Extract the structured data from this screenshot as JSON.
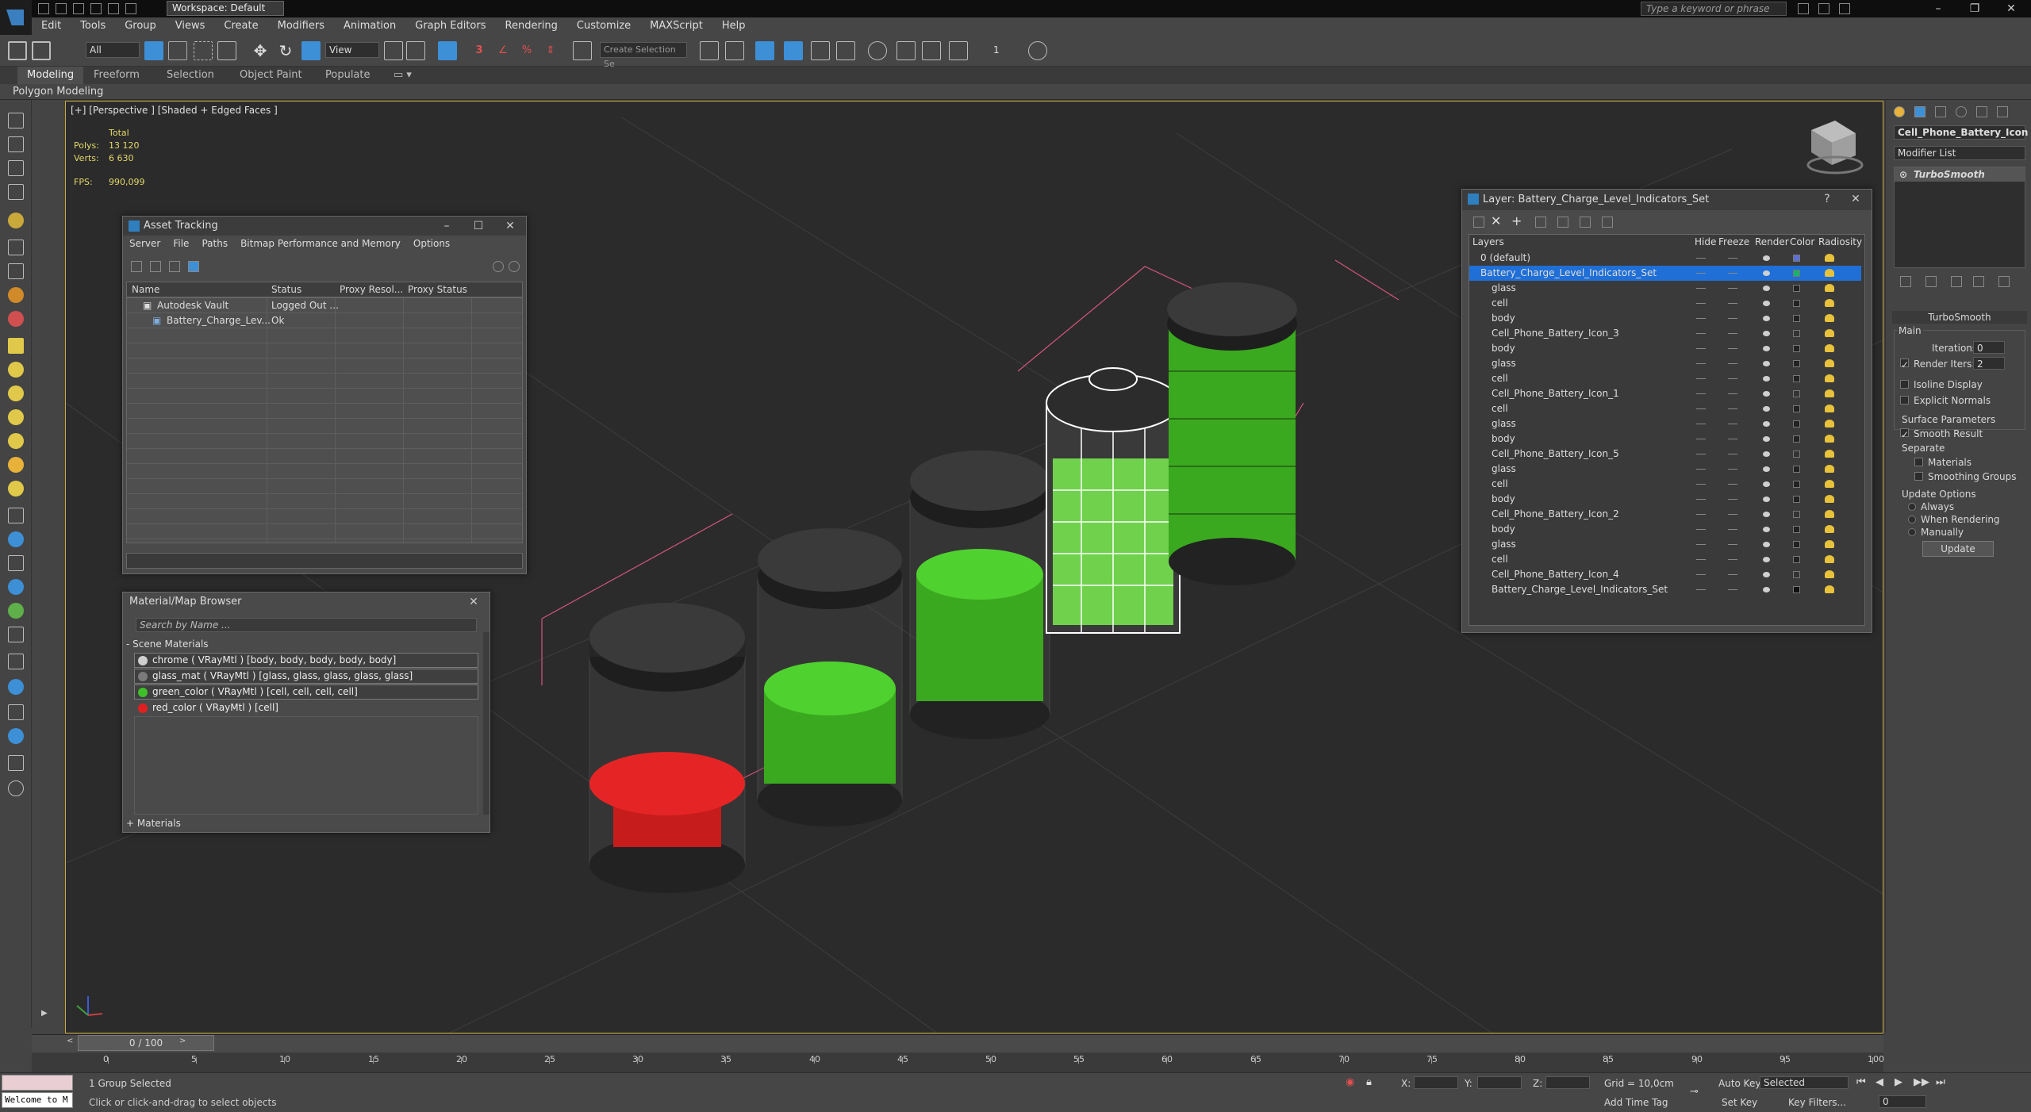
{
  "titlebar": {
    "workspace": "Workspace: Default",
    "search_placeholder": "Type a keyword or phrase"
  },
  "menubar": {
    "items": [
      "Edit",
      "Tools",
      "Group",
      "Views",
      "Create",
      "Modifiers",
      "Animation",
      "Graph Editors",
      "Rendering",
      "Customize",
      "MAXScript",
      "Help"
    ]
  },
  "toolbar": {
    "filter": "All",
    "ref_coord": "View",
    "named_selection": "Create Selection Se",
    "snap_count": "1"
  },
  "ribbon": {
    "tabs": [
      "Modeling",
      "Freeform",
      "Selection",
      "Object Paint",
      "Populate"
    ],
    "active_tab": "Modeling",
    "subpanel": "Polygon Modeling"
  },
  "viewport": {
    "label": "[+] [Perspective ] [Shaded + Edged Faces ]",
    "stats_header": "Total",
    "polys_label": "Polys:",
    "polys_value": "13 120",
    "verts_label": "Verts:",
    "verts_value": "6 630",
    "fps_label": "FPS:",
    "fps_value": "990,099"
  },
  "asset_tracking": {
    "title": "Asset Tracking",
    "menu": [
      "Server",
      "File",
      "Paths",
      "Bitmap Performance and Memory",
      "Options"
    ],
    "columns": [
      "Name",
      "Status",
      "Proxy Resol...",
      "Proxy Status"
    ],
    "rows": [
      {
        "name": "Autodesk Vault",
        "status": "Logged Out ..."
      },
      {
        "name": "Battery_Charge_Lev...",
        "status": "Ok"
      }
    ]
  },
  "material_browser": {
    "title": "Material/Map Browser",
    "search_placeholder": "Search by Name ...",
    "section": "- Scene Materials",
    "items": [
      {
        "label": "chrome ( VRayMtl ) [body, body, body, body, body]",
        "color": "#cfcfcf"
      },
      {
        "label": "glass_mat ( VRayMtl ) [glass, glass, glass, glass, glass]",
        "color": "#7a7a7a"
      },
      {
        "label": "green_color ( VRayMtl ) [cell, cell, cell, cell]",
        "color": "#3fbf2a"
      },
      {
        "label": "red_color ( VRayMtl ) [cell]",
        "color": "#e02020"
      }
    ],
    "footer": "+ Materials"
  },
  "layer_explorer": {
    "title": "Layer: Battery_Charge_Level_Indicators_Set",
    "columns": [
      "Layers",
      "Hide",
      "Freeze",
      "Render",
      "Color",
      "Radiosity"
    ],
    "rows": [
      {
        "name": "0 (default)",
        "indent": 1,
        "swatch": "#5a6fd8"
      },
      {
        "name": "Battery_Charge_Level_Indicators_Set",
        "indent": 1,
        "selected": true,
        "swatch": "#1ab36a"
      },
      {
        "name": "glass",
        "indent": 2,
        "swatch": "#222"
      },
      {
        "name": "cell",
        "indent": 2,
        "swatch": "#222"
      },
      {
        "name": "body",
        "indent": 2,
        "swatch": "#222"
      },
      {
        "name": "Cell_Phone_Battery_Icon_3",
        "indent": 2,
        "swatch": "#333"
      },
      {
        "name": "body",
        "indent": 2,
        "swatch": "#222"
      },
      {
        "name": "glass",
        "indent": 2,
        "swatch": "#222"
      },
      {
        "name": "cell",
        "indent": 2,
        "swatch": "#222"
      },
      {
        "name": "Cell_Phone_Battery_Icon_1",
        "indent": 2,
        "swatch": "#333"
      },
      {
        "name": "cell",
        "indent": 2,
        "swatch": "#222"
      },
      {
        "name": "glass",
        "indent": 2,
        "swatch": "#222"
      },
      {
        "name": "body",
        "indent": 2,
        "swatch": "#222"
      },
      {
        "name": "Cell_Phone_Battery_Icon_5",
        "indent": 2,
        "swatch": "#333"
      },
      {
        "name": "glass",
        "indent": 2,
        "swatch": "#222"
      },
      {
        "name": "cell",
        "indent": 2,
        "swatch": "#222"
      },
      {
        "name": "body",
        "indent": 2,
        "swatch": "#222"
      },
      {
        "name": "Cell_Phone_Battery_Icon_2",
        "indent": 2,
        "swatch": "#333"
      },
      {
        "name": "body",
        "indent": 2,
        "swatch": "#222"
      },
      {
        "name": "glass",
        "indent": 2,
        "swatch": "#222"
      },
      {
        "name": "cell",
        "indent": 2,
        "swatch": "#222"
      },
      {
        "name": "Cell_Phone_Battery_Icon_4",
        "indent": 2,
        "swatch": "#333"
      },
      {
        "name": "Battery_Charge_Level_Indicators_Set",
        "indent": 2,
        "swatch": "#111"
      }
    ]
  },
  "command_panel": {
    "object_name": "Cell_Phone_Battery_Icon",
    "modifier_list": "Modifier List",
    "stack_item": "TurboSmooth",
    "rollout_title": "TurboSmooth",
    "main_label": "Main",
    "iterations_label": "Iterations:",
    "iterations_value": "0",
    "render_iters_label": "Render Iters:",
    "render_iters_value": "2",
    "isoline_label": "Isoline Display",
    "explicit_normals_label": "Explicit Normals",
    "surface_params_label": "Surface Parameters",
    "smooth_result_label": "Smooth Result",
    "separate_label": "Separate",
    "materials_label": "Materials",
    "smoothing_groups_label": "Smoothing Groups",
    "update_options_label": "Update Options",
    "always_label": "Always",
    "when_rendering_label": "When Rendering",
    "manually_label": "Manually",
    "update_button": "Update"
  },
  "timeline": {
    "frame_counter": "0 / 100",
    "ticks": [
      "0",
      "5",
      "10",
      "15",
      "20",
      "25",
      "30",
      "35",
      "40",
      "45",
      "50",
      "55",
      "60",
      "65",
      "70",
      "75",
      "80",
      "85",
      "90",
      "95",
      "100"
    ]
  },
  "statusbar": {
    "maxscript_text": "Welcome to M",
    "selection_status": "1 Group Selected",
    "prompt": "Click or click-and-drag to select objects",
    "x_label": "X:",
    "y_label": "Y:",
    "z_label": "Z:",
    "grid": "Grid = 10,0cm",
    "add_time_tag": "Add Time Tag",
    "auto_key": "Auto Key",
    "selected_dropdown": "Selected",
    "set_key": "Set Key",
    "key_filters": "Key Filters...",
    "frame_value": "0"
  },
  "colors": {
    "viewport_border": "#c9a93a",
    "selection_blue": "#1f6fd6",
    "battery_green": "#3fbf2a",
    "battery_red": "#e02020"
  }
}
